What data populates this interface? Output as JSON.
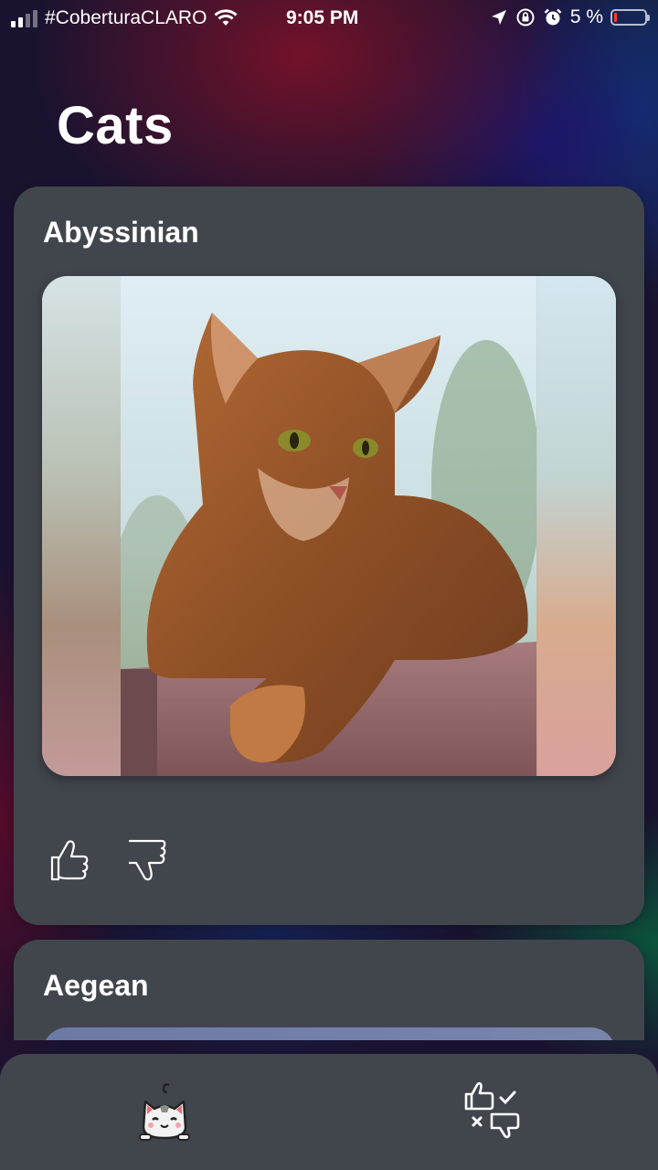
{
  "status_bar": {
    "carrier": "#CoberturaCLARO",
    "time": "9:05 PM",
    "battery": "5 %",
    "battery_level": 0.05,
    "icons": [
      "signal-icon",
      "wifi-icon",
      "location-arrow-icon",
      "rotation-lock-icon",
      "alarm-clock-icon",
      "battery-icon"
    ]
  },
  "header": {
    "title": "Cats"
  },
  "cards": [
    {
      "title": "Abyssinian",
      "actions": [
        "thumbs-up-icon",
        "thumbs-down-icon"
      ]
    },
    {
      "title": "Aegean"
    }
  ],
  "tab_bar": {
    "tabs": [
      {
        "icon": "cat-face-icon"
      },
      {
        "icon": "rated-cats-icon"
      }
    ]
  },
  "colors": {
    "card": "#41464d",
    "tab_bar": "#41464d",
    "battery_low": "#ff3b30"
  }
}
